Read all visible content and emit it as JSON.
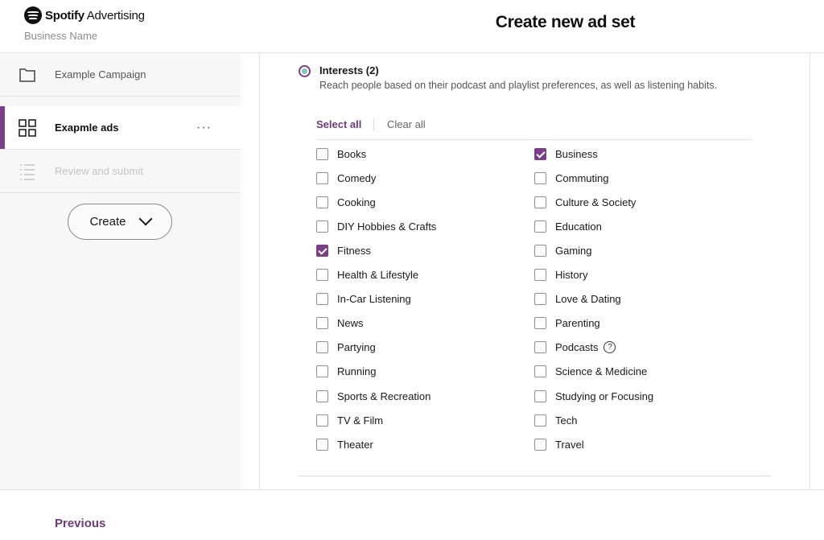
{
  "header": {
    "brand": "Spotify",
    "brand_sub": "Advertising",
    "business_name": "Business Name",
    "title": "Create new ad set"
  },
  "sidebar": {
    "items": [
      {
        "label": "Example Campaign",
        "icon": "folder-icon",
        "state": "normal"
      },
      {
        "label": "Exapmle ads",
        "icon": "grid-icon",
        "state": "active",
        "more": "···"
      },
      {
        "label": "Review and submit",
        "icon": "list-icon",
        "state": "disabled"
      }
    ],
    "create_label": "Create"
  },
  "interests": {
    "title": "Interests (2)",
    "description": "Reach people based on their podcast and playlist preferences, as well as listening habits.",
    "select_all": "Select all",
    "clear_all": "Clear all",
    "left": [
      {
        "label": "Books",
        "checked": false
      },
      {
        "label": "Comedy",
        "checked": false
      },
      {
        "label": "Cooking",
        "checked": false
      },
      {
        "label": "DIY Hobbies & Crafts",
        "checked": false
      },
      {
        "label": "Fitness",
        "checked": true
      },
      {
        "label": "Health & Lifestyle",
        "checked": false
      },
      {
        "label": "In-Car Listening",
        "checked": false
      },
      {
        "label": "News",
        "checked": false
      },
      {
        "label": "Partying",
        "checked": false
      },
      {
        "label": "Running",
        "checked": false
      },
      {
        "label": "Sports & Recreation",
        "checked": false
      },
      {
        "label": "TV & Film",
        "checked": false
      },
      {
        "label": "Theater",
        "checked": false
      }
    ],
    "right": [
      {
        "label": "Business",
        "checked": true
      },
      {
        "label": "Commuting",
        "checked": false
      },
      {
        "label": "Culture & Society",
        "checked": false
      },
      {
        "label": "Education",
        "checked": false
      },
      {
        "label": "Gaming",
        "checked": false
      },
      {
        "label": "History",
        "checked": false
      },
      {
        "label": "Love & Dating",
        "checked": false
      },
      {
        "label": "Parenting",
        "checked": false
      },
      {
        "label": "Podcasts",
        "checked": false,
        "help": "?"
      },
      {
        "label": "Science & Medicine",
        "checked": false
      },
      {
        "label": "Studying or Focusing",
        "checked": false
      },
      {
        "label": "Tech",
        "checked": false
      },
      {
        "label": "Travel",
        "checked": false
      }
    ]
  },
  "footer": {
    "previous_label": "Previous"
  },
  "colors": {
    "accent": "#7b3f8a",
    "link": "#6d3a7d",
    "radio_inner": "#7ec8c0"
  }
}
